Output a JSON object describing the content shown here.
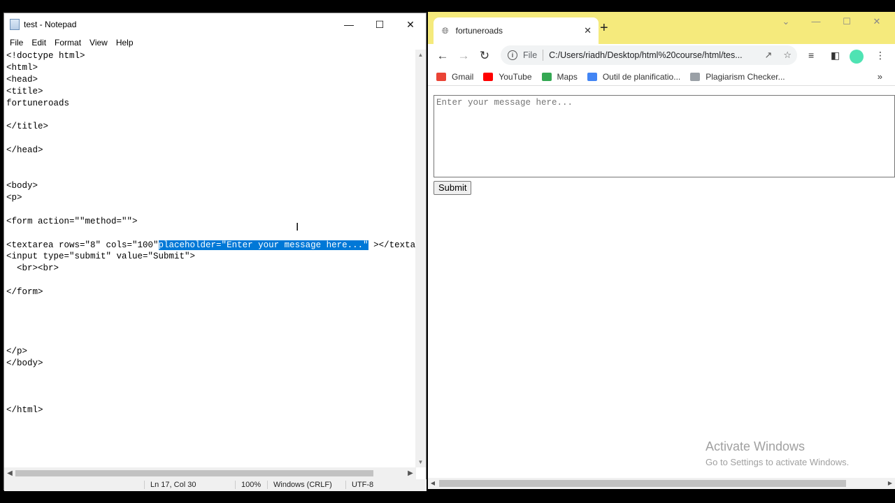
{
  "notepad": {
    "title": "test - Notepad",
    "menu": [
      "File",
      "Edit",
      "Format",
      "View",
      "Help"
    ],
    "code_lines_before": "<!doctype html>\n<html>\n<head>\n<title>\nfortuneroads\n\n</title>\n\n</head>\n\n\n<body>\n<p>\n\n<form action=\"\"method=\"\">\n\n<textarea rows=\"8\" cols=\"100\"",
    "code_selected": "placeholder=\"Enter your message here...\"",
    "code_after_selection": " ></texta",
    "code_lines_after": "<input type=\"submit\" value=\"Submit\">\n  <br><br>\n\n</form>\n\n\n\n\n</p>\n</body>\n\n\n\n</html>",
    "status": {
      "position": "Ln 17, Col 30",
      "zoom": "100%",
      "line_ending": "Windows (CRLF)",
      "encoding": "UTF-8"
    }
  },
  "chrome": {
    "tab_title": "fortuneroads",
    "address_prefix": "File",
    "url": "C:/Users/riadh/Desktop/html%20course/html/tes...",
    "bookmarks": [
      {
        "label": "Gmail",
        "color": "#ea4335"
      },
      {
        "label": "YouTube",
        "color": "#ff0000"
      },
      {
        "label": "Maps",
        "color": "#34a853"
      },
      {
        "label": "Outil de planificatio...",
        "color": "#4285f4"
      },
      {
        "label": "Plagiarism Checker...",
        "color": "#9aa0a6"
      }
    ],
    "textarea_placeholder": "Enter your message here...",
    "submit_label": "Submit",
    "tab_bar_color": "#f5ea7c"
  },
  "watermark": {
    "line1": "Activate Windows",
    "line2": "Go to Settings to activate Windows."
  }
}
